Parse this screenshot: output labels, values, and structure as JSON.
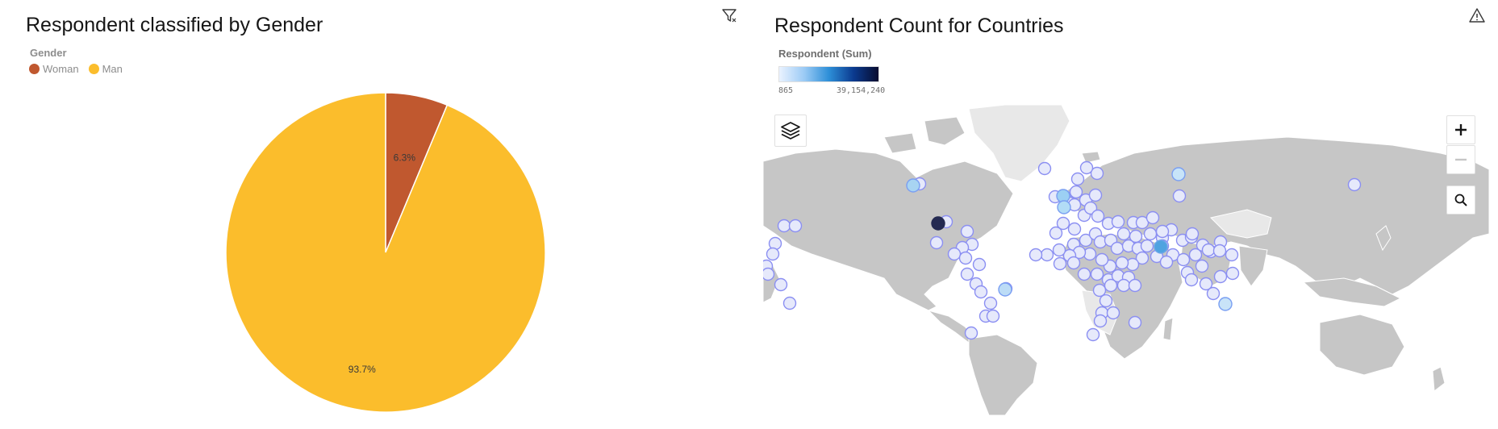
{
  "pie_panel": {
    "title": "Respondent classified by Gender",
    "legend_title": "Gender",
    "legend": [
      {
        "label": "Woman",
        "color": "#c0582f"
      },
      {
        "label": "Man",
        "color": "#fbbd2c"
      }
    ],
    "icons": {
      "top_right": "filter-icon"
    }
  },
  "map_panel": {
    "title": "Respondent Count for Countries",
    "color_legend": {
      "title": "Respondent (Sum)",
      "min_label": "865",
      "max_label": "39,154,240"
    },
    "icons": {
      "top_right": "warning-icon",
      "layers": "layers-icon",
      "zoom_in": "plus-icon",
      "zoom_out": "minus-icon",
      "search": "search-icon"
    }
  },
  "chart_data": [
    {
      "type": "pie",
      "title": "Respondent classified by Gender",
      "legend_title": "Gender",
      "categories": [
        "Woman",
        "Man"
      ],
      "values": [
        6.3,
        93.7
      ],
      "data_labels": [
        "6.3%",
        "93.7%"
      ],
      "colors": [
        "#c0582f",
        "#fbbd2c"
      ],
      "legend_position": "top-left"
    },
    {
      "type": "map",
      "title": "Respondent Count for Countries",
      "color_scale_title": "Respondent (Sum)",
      "color_range": [
        865,
        39154240
      ],
      "color_range_labels": [
        "865",
        "39,154,240"
      ]
    }
  ]
}
